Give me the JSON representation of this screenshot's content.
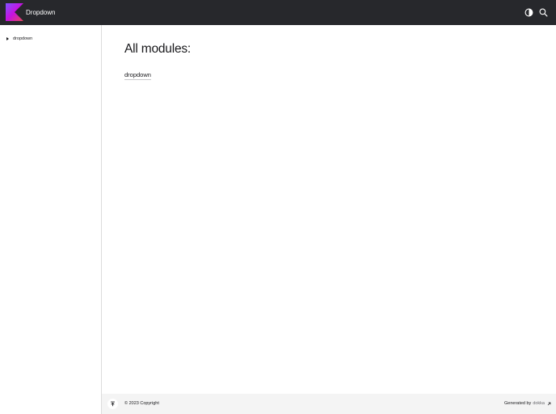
{
  "header": {
    "title": "Dropdown",
    "logo_icon": "kotlin-logo-icon",
    "theme_icon": "theme-toggle-icon",
    "search_icon": "search-icon",
    "background": "#27282c"
  },
  "sidebar": {
    "items": [
      {
        "label": "dropdown",
        "icon": "caret-right-icon"
      }
    ]
  },
  "main": {
    "title": "All modules:",
    "modules": [
      {
        "label": "dropdown"
      }
    ]
  },
  "footer": {
    "scroll_top_icon": "scroll-to-top-icon",
    "copyright": "© 2023 Copyright",
    "generated_by": "Generated by",
    "dokka_label": "dokka",
    "external_icon": "external-link-icon"
  }
}
